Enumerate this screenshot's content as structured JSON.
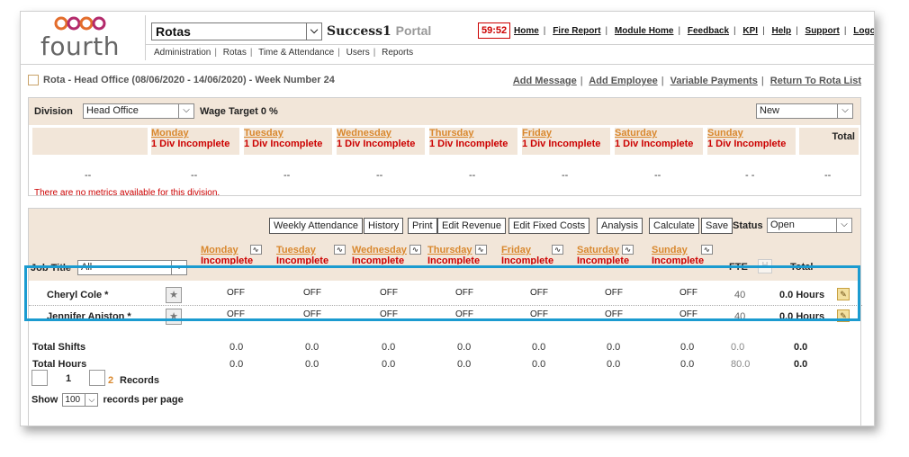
{
  "header": {
    "module": "Rotas",
    "portal_name": "Success1",
    "portal_suffix": "Portal",
    "clock": "59:52",
    "links": [
      "Home",
      "Fire Report",
      "Module Home",
      "Feedback",
      "KPI",
      "Help",
      "Support",
      "Logout"
    ],
    "submenu": [
      "Administration",
      "Rotas",
      "Time & Attendance",
      "Users",
      "Reports"
    ],
    "logo_text": "fourth"
  },
  "rota": {
    "title": "Rota - Head Office (08/06/2020 - 14/06/2020) - Week Number 24",
    "actions": [
      "Add Message",
      "Add Employee",
      "Variable Payments",
      "Return To Rota List"
    ]
  },
  "division_panel": {
    "division_label": "Division",
    "division_value": "Head Office",
    "wage_target": "Wage Target 0 %",
    "view_value": "New",
    "total_label": "Total",
    "days": [
      {
        "name": "Monday",
        "status": "1 Div Incomplete",
        "metric": "--"
      },
      {
        "name": "Tuesday",
        "status": "1 Div Incomplete",
        "metric": "--"
      },
      {
        "name": "Wednesday",
        "status": "1 Div Incomplete",
        "metric": "--"
      },
      {
        "name": "Thursday",
        "status": "1 Div Incomplete",
        "metric": "--"
      },
      {
        "name": "Friday",
        "status": "1 Div Incomplete",
        "metric": "--"
      },
      {
        "name": "Saturday",
        "status": "1 Div Incomplete",
        "metric": "--"
      },
      {
        "name": "Sunday",
        "status": "1 Div Incomplete",
        "metric": "- -"
      }
    ],
    "first_metric": "--",
    "total_metric": "--",
    "no_metrics": "There are no metrics available for this division."
  },
  "toolbar": {
    "buttons": [
      "Weekly Attendance",
      "History",
      "Print",
      "Edit Revenue",
      "Edit Fixed Costs",
      "Analysis",
      "Calculate",
      "Save"
    ],
    "status_label": "Status",
    "status_value": "Open"
  },
  "grid": {
    "job_title_label": "Job Title",
    "job_title_value": "All",
    "days": [
      {
        "name": "Monday",
        "status": "Incomplete"
      },
      {
        "name": "Tuesday",
        "status": "Incomplete"
      },
      {
        "name": "Wednesday",
        "status": "Incomplete"
      },
      {
        "name": "Thursday",
        "status": "Incomplete"
      },
      {
        "name": "Friday",
        "status": "Incomplete"
      },
      {
        "name": "Saturday",
        "status": "Incomplete"
      },
      {
        "name": "Sunday",
        "status": "Incomplete"
      }
    ],
    "fte_label": "FTE",
    "h_label": "H",
    "total_label": "Total",
    "employees": [
      {
        "name": "Cheryl Cole *",
        "shifts": [
          "OFF",
          "OFF",
          "OFF",
          "OFF",
          "OFF",
          "OFF",
          "OFF"
        ],
        "fte": "40",
        "total": "0.0 Hours"
      },
      {
        "name": "Jennifer Aniston *",
        "shifts": [
          "OFF",
          "OFF",
          "OFF",
          "OFF",
          "OFF",
          "OFF",
          "OFF"
        ],
        "fte": "40",
        "total": "0.0 Hours"
      }
    ],
    "totals": [
      {
        "label": "Total Shifts",
        "values": [
          "0.0",
          "0.0",
          "0.0",
          "0.0",
          "0.0",
          "0.0",
          "0.0"
        ],
        "fte": "0.0",
        "total": "0.0"
      },
      {
        "label": "Total Hours",
        "values": [
          "0.0",
          "0.0",
          "0.0",
          "0.0",
          "0.0",
          "0.0",
          "0.0"
        ],
        "fte": "80.0",
        "total": "0.0"
      }
    ]
  },
  "pager": {
    "page": "1",
    "page_count": "2",
    "records_label": "Records",
    "show_label": "Show",
    "per_page": "100",
    "per_page_label": "records per page"
  }
}
